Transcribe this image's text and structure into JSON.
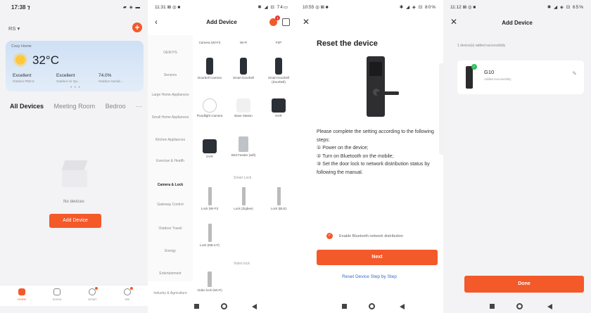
{
  "panel1": {
    "status_time": "17:38 ⁊",
    "status_icons": "▰ ◈ ▬",
    "home_selector": "RS ▾",
    "plus": "+",
    "weather": {
      "city": "Cozy Home",
      "temp": "32°C",
      "stats": [
        {
          "value": "Excellent",
          "label": "Outdoor PM2.5"
        },
        {
          "value": "Excellent",
          "label": "Outdoor Air Qu..."
        },
        {
          "value": "74.0%",
          "label": "Outdoor Humid..."
        }
      ],
      "dots": "• • •"
    },
    "tabs": [
      "All Devices",
      "Meeting Room",
      "Bedroo",
      "···"
    ],
    "empty_text": "No devices",
    "add_button": "Add Device",
    "tabbar": [
      "Home",
      "Scene",
      "Smart",
      "Me"
    ]
  },
  "panel2": {
    "status_time": "11:31 ⊠ ◎ ■",
    "status_icons": "✱ ◢ ⊡ 74▭",
    "title": "Add Device",
    "badge": "1",
    "categories": [
      "OEM PS",
      "Sensors",
      "Large Home Appliances",
      "Small Home Appliances",
      "Kitchen Appliances",
      "Exercise & Health",
      "Camera & Lock",
      "Gateway Control",
      "Outdoor Travel",
      "Energy",
      "Entertainment",
      "Industry & Agriculture"
    ],
    "devices": [
      {
        "name": "Camera (Wi-Fi)"
      },
      {
        "name": "Wi-Fi"
      },
      {
        "name": "P2P"
      },
      {
        "name": "Doorbell Camera"
      },
      {
        "name": "Smart Doorbell"
      },
      {
        "name": "Smart Doorbell (Doorbell)"
      },
      {
        "name": "Floodlight Camera"
      },
      {
        "name": "Base Station"
      },
      {
        "name": "NVR"
      },
      {
        "name": "DVR"
      },
      {
        "name": "Bird Feeder (wifi)"
      },
      {
        "name": "Lock (Wi-Fi)"
      },
      {
        "name": "Lock (Zigbee)"
      },
      {
        "name": "Lock (BLE)"
      },
      {
        "name": "Lock (NB-IoT)"
      },
      {
        "name": "Video lock (Wi-Fi)"
      }
    ],
    "group_smart_lock": "Smart Lock",
    "group_video_lock": "Video lock"
  },
  "panel3": {
    "status_time": "10:55 ◎ ⊠ ■",
    "status_icons": "✱ ◢ ◈ ⊡ 80%",
    "close": "✕",
    "title": "Reset the device",
    "instructions": [
      "Please complete the setting according to the following steps:",
      "① Power on the device;",
      "② Turn on Bluetooth on the mobile;",
      "③ Set the door lock to network distribution status by following the manual."
    ],
    "checkbox_label": "Enable Bluetooth network distribution",
    "next_button": "Next",
    "reset_link": "Reset Device Step by Step"
  },
  "panel4": {
    "status_time": "11:12 ⊠ ◎ ■",
    "status_icons": "✱ ◢ ◈ ⊡ 65%",
    "close": "✕",
    "title": "Add Device",
    "added_message": "1 device(s) added successfully",
    "device_name": "G10",
    "device_sub": "Added successfully",
    "done_button": "Done"
  },
  "colors": {
    "accent": "#f4592a",
    "link": "#2f6ec9",
    "success": "#2ebd5a"
  }
}
